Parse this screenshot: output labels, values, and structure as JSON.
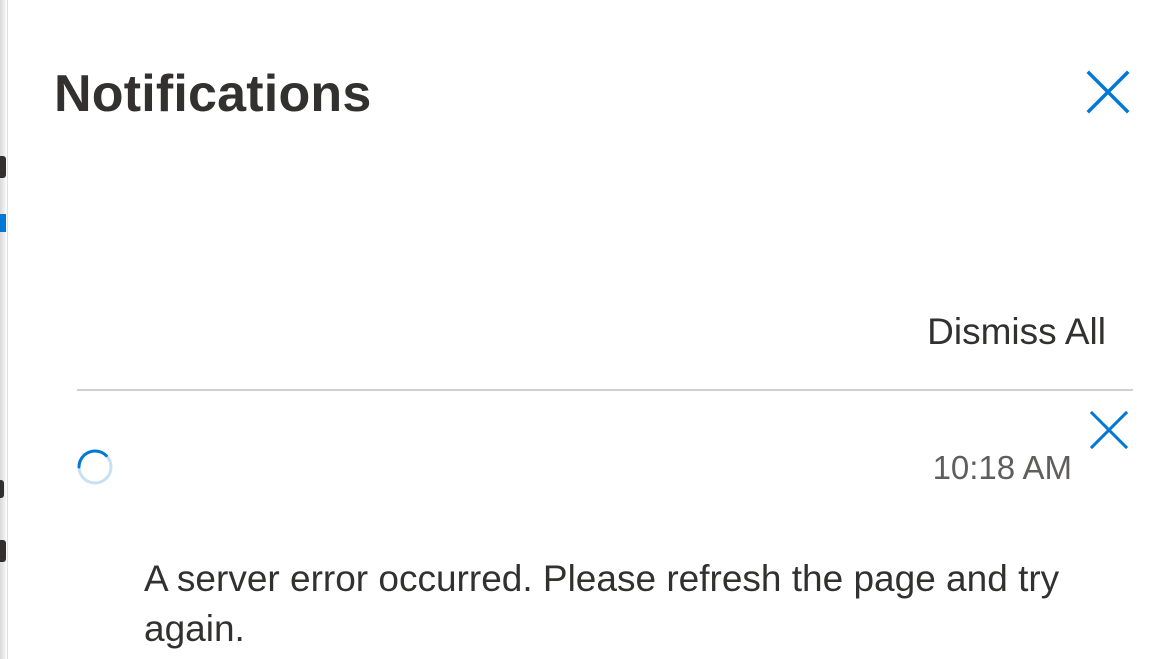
{
  "panel": {
    "title": "Notifications",
    "close_icon": "close-icon",
    "dismiss_all_label": "Dismiss All"
  },
  "notifications": [
    {
      "status_icon": "loading-spinner-icon",
      "time": "10:18 AM",
      "message": "A server error occurred. Please refresh the page and try again.",
      "close_icon": "close-icon"
    }
  ],
  "colors": {
    "accent": "#0078d4",
    "text_primary": "#323130",
    "text_secondary": "#605e5c",
    "divider": "#d2d0ce",
    "spinner_track": "#c7e0f4"
  }
}
